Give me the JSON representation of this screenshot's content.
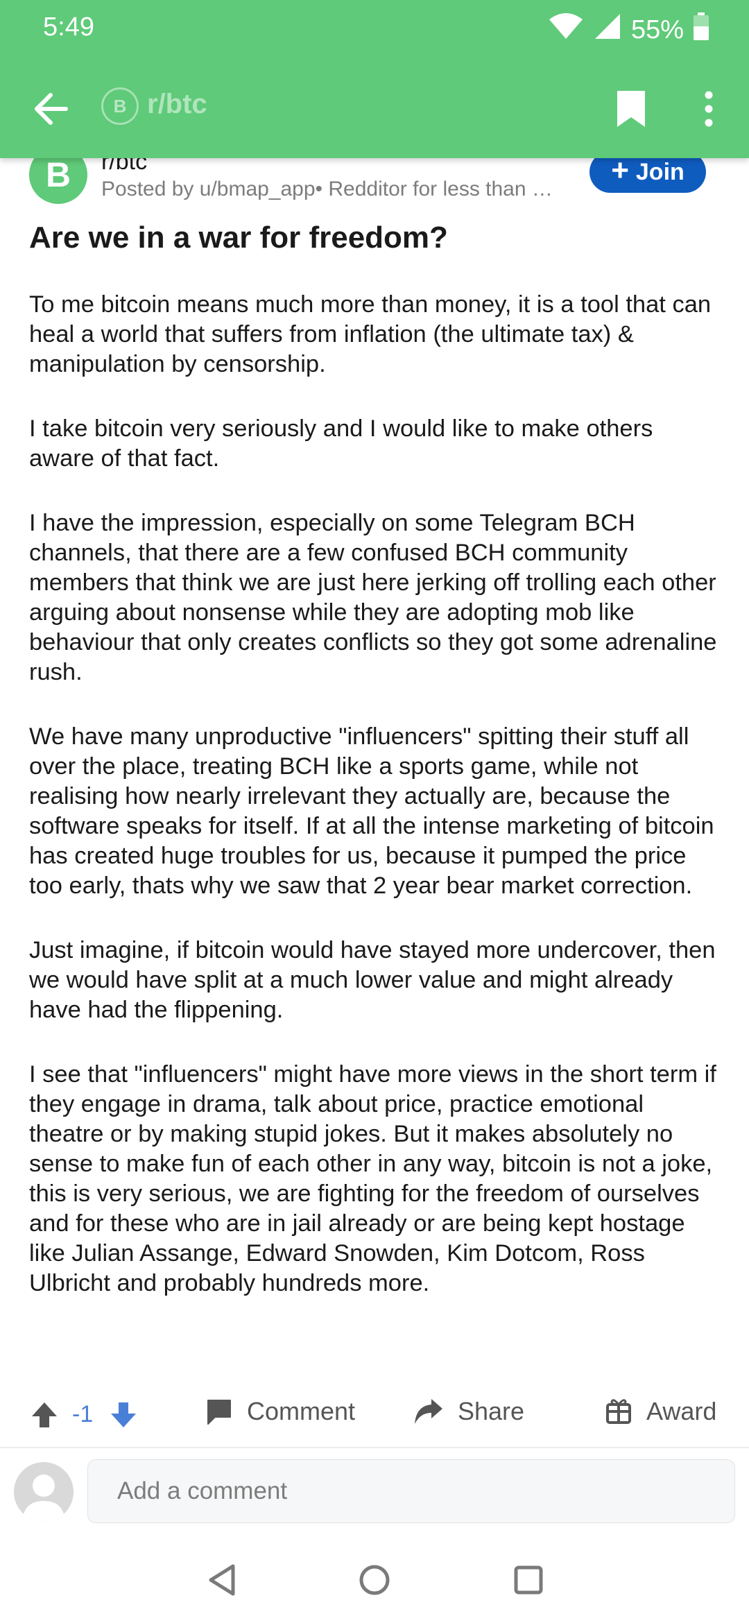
{
  "status_bar": {
    "time": "5:49",
    "battery": "55%"
  },
  "app_bar": {
    "title": "r/btc",
    "sub_icon_letter": "B"
  },
  "post": {
    "subreddit": "r/btc",
    "meta": "Posted by u/bmap_app• Redditor for less than …",
    "join_label": "Join",
    "avatar_letter": "B",
    "title": "Are we in a war for freedom?",
    "body": [
      "To me bitcoin means much more than money, it is a tool that can heal a world that suffers from inflation (the ultimate tax) & manipulation by censorship.",
      "I take bitcoin very seriously and I would like to make others aware of that fact.",
      "I have the impression, especially on some Telegram BCH channels, that there are a few confused BCH community members that think we are just here jerking off trolling each other arguing about nonsense while they are adopting mob like behaviour that only creates conflicts so they got some adrenaline rush.",
      "We have many unproductive \"influencers\" spitting their stuff all over the place, treating BCH like a sports game, while not realising how nearly irrelevant they actually are, because the software speaks for itself. If at all the intense marketing of bitcoin has created huge troubles for us, because it pumped the price too early, thats why we saw that 2 year bear market correction.",
      "Just imagine, if bitcoin would have stayed more undercover, then we would have split at a much lower value and might already have had the flippening.",
      "I see that \"influencers\" might have more views in the short term if they engage in drama, talk about price, practice emotional theatre or by making stupid jokes. But it makes absolutely no sense to make fun of each other in any way, bitcoin is not a joke, this is very serious, we are fighting for the freedom of ourselves and for these who are in jail already or are being kept hostage like Julian Assange, Edward Snowden, Kim Dotcom, Ross Ulbricht and probably hundreds more."
    ]
  },
  "actions": {
    "score": "-1",
    "comment_label": "Comment",
    "share_label": "Share",
    "award_label": "Award"
  },
  "comment_box": {
    "placeholder": "Add a comment"
  },
  "colors": {
    "header": "#5fca79",
    "join": "#0f5cbf",
    "score": "#4a7fd8"
  }
}
